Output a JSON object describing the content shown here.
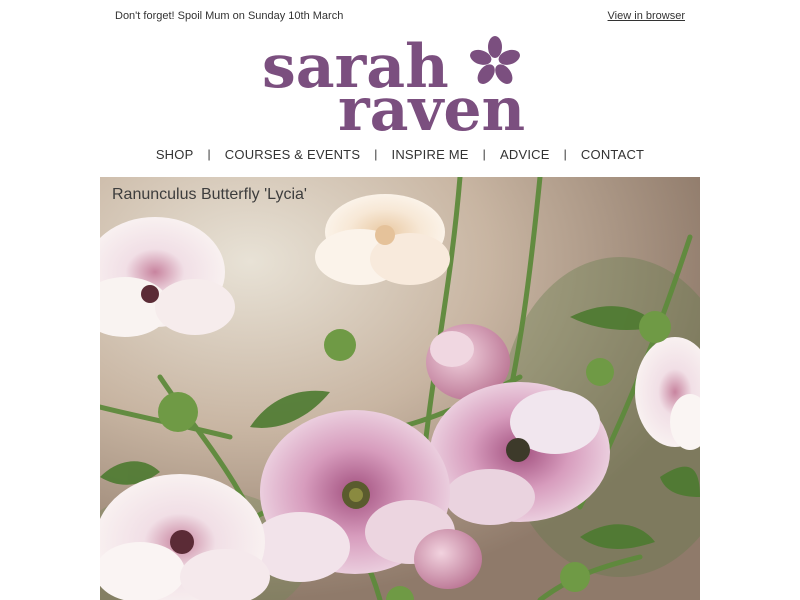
{
  "header": {
    "reminder": "Don't forget! Spoil Mum on Sunday 10th March",
    "view_in_browser": "View in browser"
  },
  "brand": {
    "logo_line1": "sarah",
    "logo_line2": "raven",
    "logo_color": "#7b4f7f"
  },
  "nav": {
    "items": [
      "SHOP",
      "COURSES & EVENTS",
      "INSPIRE ME",
      "ADVICE",
      "CONTACT"
    ],
    "separator": "|"
  },
  "hero": {
    "caption": "Ranunculus Butterfly 'Lycia'"
  }
}
